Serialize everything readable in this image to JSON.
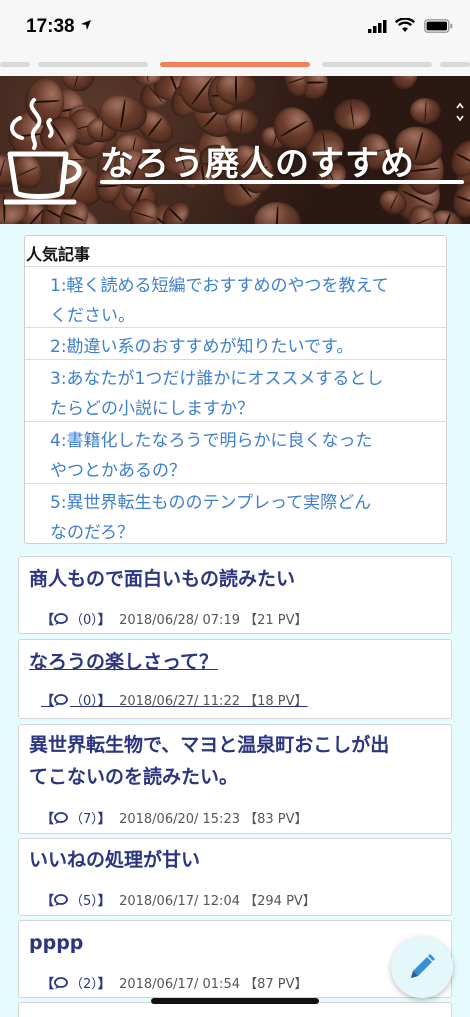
{
  "status_bar": {
    "time": "17:38"
  },
  "banner": {
    "title": "なろう廃人のすすめ"
  },
  "popular": {
    "heading": "人気記事",
    "items": [
      {
        "line1": "1:軽く読める短編でおすすめのやつを教えて",
        "line2": "ください。"
      },
      {
        "line1": "2:勘違い系のおすすめが知りたいです。",
        "line2": ""
      },
      {
        "line1": "3:あなたが1つだけ誰かにオススメするとし",
        "line2": "たらどの小説にしますか？"
      },
      {
        "line1": "4:書籍化したなろうで明らかに良くなった",
        "line2": "やつとかあるの？"
      },
      {
        "line1": "5:異世界転生もののテンプレって実際どん",
        "line2": "なのだろ？"
      }
    ]
  },
  "articles": [
    {
      "title": "商人もので面白いもの読みたい",
      "title2": "",
      "comments": "（0）",
      "date": "2018/06/28/ 07:19",
      "pv": "【21 PV】"
    },
    {
      "title": "なろうの楽しさって？",
      "title2": "",
      "comments": "（0）",
      "date": "2018/06/27/ 11:22",
      "pv": "【18 PV】"
    },
    {
      "title": "異世界転生物で、マヨと温泉町おこしが出",
      "title2": "てこないのを読みたい。",
      "comments": "（7）",
      "date": "2018/06/20/ 15:23",
      "pv": "【83 PV】"
    },
    {
      "title": "いいねの処理が甘い",
      "title2": "",
      "comments": "（5）",
      "date": "2018/06/17/ 12:04",
      "pv": "【294 PV】"
    },
    {
      "title": "pppp",
      "title2": "",
      "comments": "（2）",
      "date": "2018/06/17/ 01:54",
      "pv": "【87 PV】"
    }
  ],
  "meta_brackets": {
    "open": "【",
    "close": "】"
  },
  "colors": {
    "accent": "#f08157",
    "title": "#2b3580",
    "link": "#3d7fcf",
    "background": "#e6fbfd"
  },
  "icons": [
    "location-arrow-icon",
    "signal-icon",
    "wifi-icon",
    "battery-icon",
    "coffee-cup-icon",
    "comment-icon",
    "pencil-icon"
  ]
}
